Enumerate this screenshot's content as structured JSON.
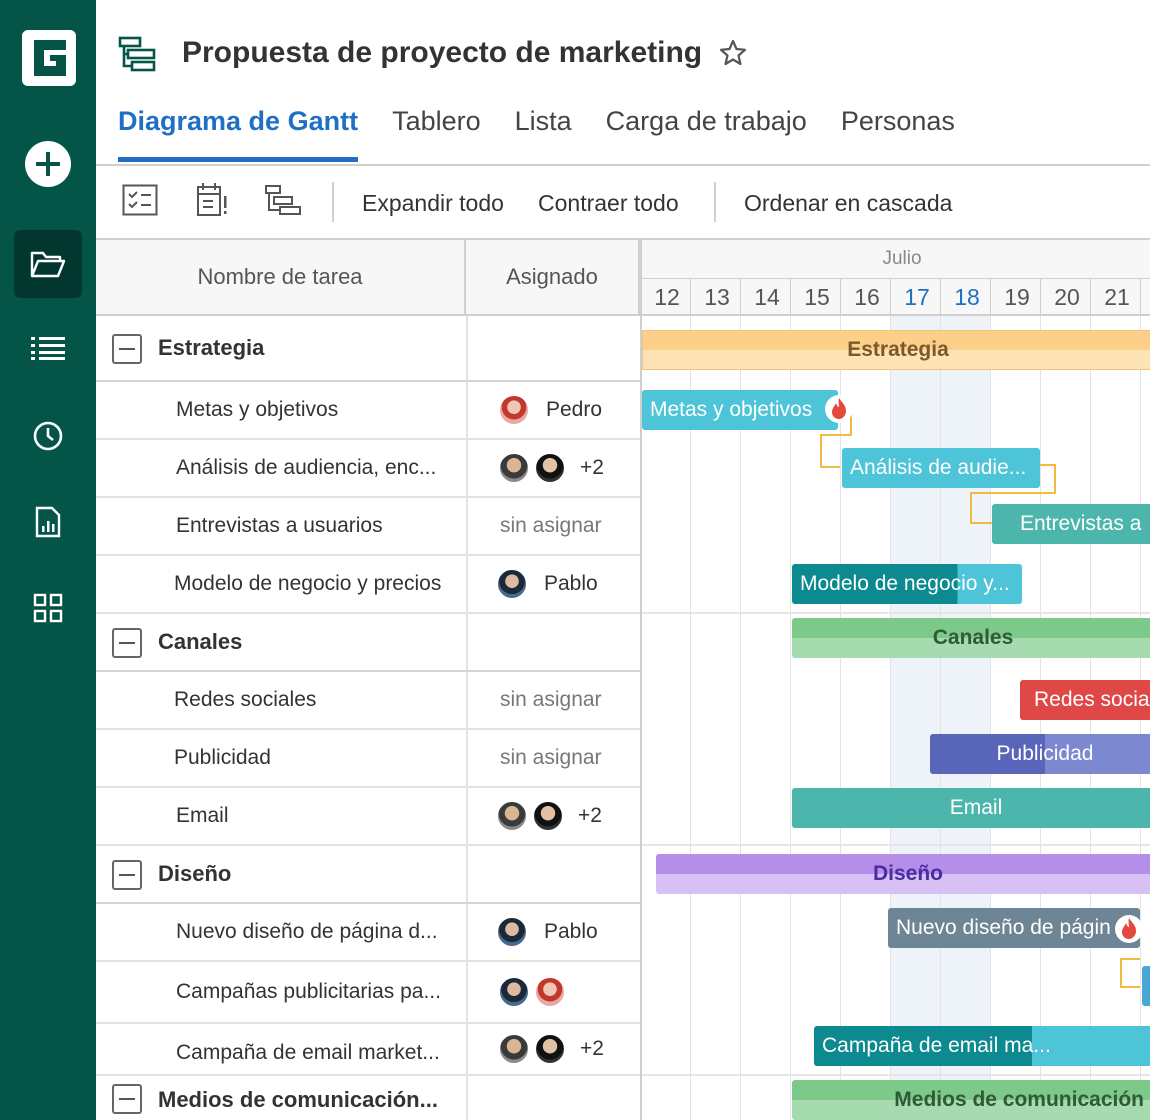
{
  "app": {
    "project_title": "Propuesta de proyecto de marketing"
  },
  "tabs": [
    {
      "label": "Diagrama de Gantt",
      "active": true
    },
    {
      "label": "Tablero",
      "active": false
    },
    {
      "label": "Lista",
      "active": false
    },
    {
      "label": "Carga de trabajo",
      "active": false
    },
    {
      "label": "Personas",
      "active": false
    }
  ],
  "toolbar": {
    "expand_all": "Expandir todo",
    "collapse_all": "Contraer todo",
    "cascade_sort": "Ordenar en cascada"
  },
  "grid": {
    "col_task": "Nombre de tarea",
    "col_assignee": "Asignado"
  },
  "timeline": {
    "month": "Julio",
    "days": [
      "12",
      "13",
      "14",
      "15",
      "16",
      "17",
      "18",
      "19",
      "20",
      "21"
    ],
    "highlight_days": [
      "17",
      "18"
    ]
  },
  "rows": [
    {
      "type": "group",
      "name": "Estrategia"
    },
    {
      "type": "task",
      "name": "Metas y objetivos",
      "assignee": "Pedro",
      "avatars": [
        "a1"
      ]
    },
    {
      "type": "task",
      "name": "Análisis de audiencia, enc...",
      "assignee": "",
      "avatars": [
        "a2",
        "a3"
      ],
      "more": "+2"
    },
    {
      "type": "task",
      "name": "Entrevistas a usuarios",
      "unassigned": "sin asignar"
    },
    {
      "type": "task",
      "name": "Modelo de negocio y precios",
      "assignee": "Pablo",
      "avatars": [
        "a4"
      ]
    },
    {
      "type": "group",
      "name": "Canales"
    },
    {
      "type": "task",
      "name": "Redes sociales",
      "unassigned": "sin asignar"
    },
    {
      "type": "task",
      "name": "Publicidad",
      "unassigned": "sin asignar"
    },
    {
      "type": "task",
      "name": "Email",
      "assignee": "",
      "avatars": [
        "a2",
        "a3"
      ],
      "more": "+2"
    },
    {
      "type": "group",
      "name": "Diseño"
    },
    {
      "type": "task",
      "name": "Nuevo diseño de página d...",
      "assignee": "Pablo",
      "avatars": [
        "a4"
      ]
    },
    {
      "type": "task",
      "name": "Campañas publicitarias pa...",
      "assignee": "",
      "avatars": [
        "a4",
        "a1"
      ]
    },
    {
      "type": "task",
      "name": "Campaña de email market...",
      "assignee": "",
      "avatars": [
        "a2",
        "a3"
      ],
      "more": "+2"
    },
    {
      "type": "group",
      "name": "Medios de comunicación..."
    }
  ],
  "bars": {
    "estrategia": "Estrategia",
    "metas": "Metas y objetivos",
    "analisis": "Análisis de audie...",
    "entrevistas": "Entrevistas a",
    "modelo": "Modelo de negocio y...",
    "canales": "Canales",
    "redes": "Redes socia",
    "publicidad": "Publicidad",
    "email": "Email",
    "diseno": "Diseño",
    "nuevo_diseno": "Nuevo diseño de págin",
    "campana_email": "Campaña de email ma...",
    "medios": "Medios de comunicación"
  },
  "colors": {
    "sidebar": "#045448",
    "accent": "#1f6fc5",
    "estrategia": "#fdd08a",
    "cyan": "#4dc4d8",
    "teal": "#4db6ac",
    "dark_teal": "#0c8a8f",
    "green": "#7dc98a",
    "red": "#e04848",
    "indigo": "#5865b8",
    "purple": "#b48ee8",
    "slate": "#6d8594"
  }
}
